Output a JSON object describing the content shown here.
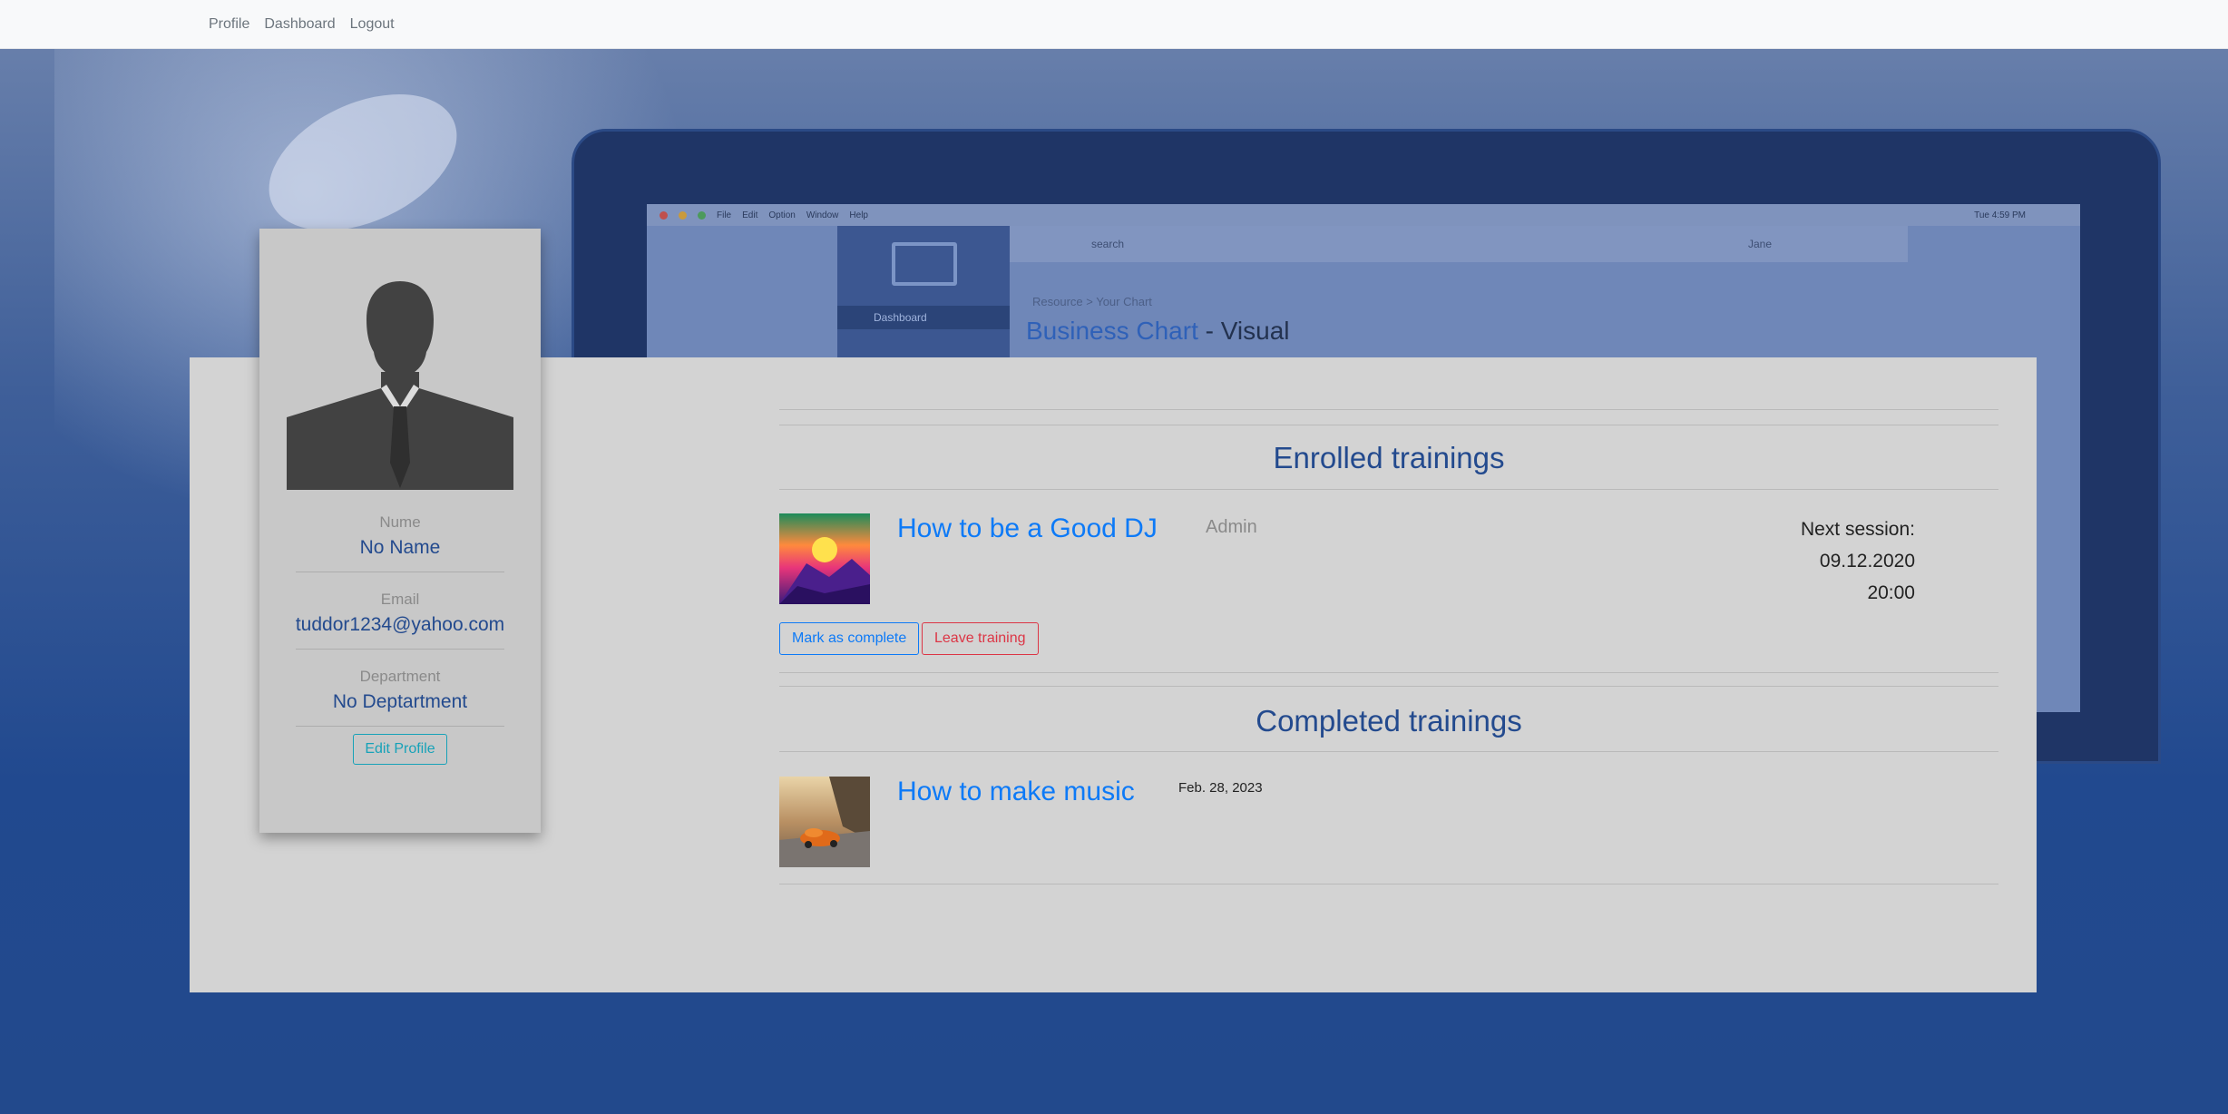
{
  "nav": {
    "links": [
      "Profile",
      "Dashboard",
      "Logout"
    ]
  },
  "background": {
    "menu_items": [
      "File",
      "Edit",
      "Option",
      "Window",
      "Help"
    ],
    "search_text": "search",
    "user_text": "Jane",
    "dashboard_label": "Dashboard",
    "breadcrumb": "Resource > Your Chart",
    "title_main": "Business Chart",
    "title_accent": " - Visual",
    "time_text": "Tue 4:59 PM"
  },
  "profile": {
    "name_label": "Nume",
    "name_value": "No Name",
    "email_label": "Email",
    "email_value": "tuddor1234@yahoo.com",
    "department_label": "Department",
    "department_value": "No Deptartment",
    "edit_button": "Edit Profile"
  },
  "enrolled": {
    "title": "Enrolled trainings",
    "items": [
      {
        "name": "How to be a Good DJ",
        "author": "Admin",
        "next_session_label": "Next session:",
        "next_session_date": "09.12.2020",
        "next_session_time": "20:00",
        "complete_button": "Mark as complete",
        "leave_button": "Leave training"
      }
    ]
  },
  "completed": {
    "title": "Completed trainings",
    "items": [
      {
        "name": "How to make music",
        "date": "Feb. 28, 2023"
      }
    ]
  },
  "colors": {
    "accent": "#0d7af7",
    "title": "#234a8e",
    "danger": "#dc3545",
    "info": "#17a2b8"
  }
}
